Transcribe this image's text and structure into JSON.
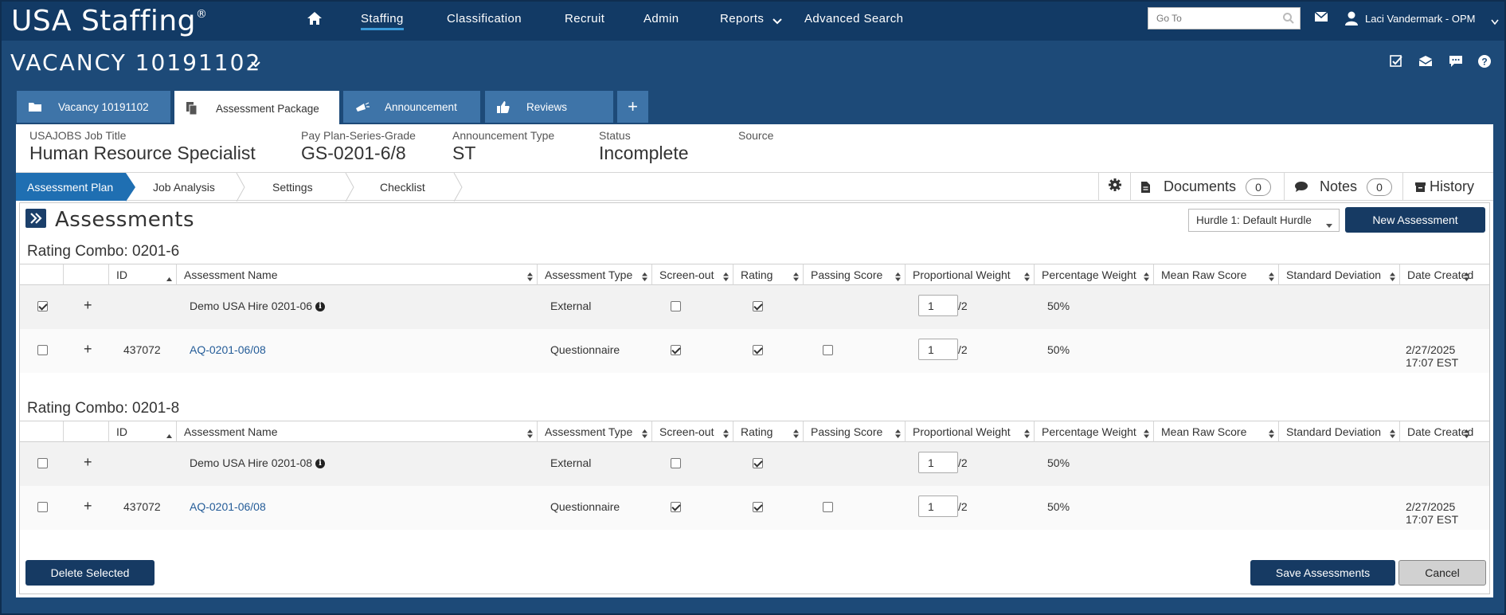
{
  "app": {
    "logo_text": "USA Staffing",
    "logo_mark": "®",
    "nav": [
      "Staffing",
      "Classification",
      "Recruit",
      "Admin",
      "Reports",
      "Advanced Search"
    ],
    "goto_placeholder": "Go To",
    "user_name": "Laci Vandermark - OPM"
  },
  "vacancy": {
    "title": "VACANCY 10191102"
  },
  "tabs": [
    "Vacancy 10191102",
    "Assessment Package",
    "Announcement",
    "Reviews",
    "+"
  ],
  "info": {
    "job_title_label": "USAJOBS Job Title",
    "job_title": "Human Resource Specialist",
    "pay_plan_label": "Pay Plan-Series-Grade",
    "pay_plan": "GS-0201-6/8",
    "announcement_type_label": "Announcement Type",
    "announcement_type": "ST",
    "status_label": "Status",
    "status": "Incomplete",
    "source_label": "Source"
  },
  "subnav": {
    "steps": [
      "Assessment Plan",
      "Job Analysis",
      "Settings",
      "Checklist"
    ],
    "documents_label": "Documents",
    "documents_count": "0",
    "notes_label": "Notes",
    "notes_count": "0",
    "history_label": "History"
  },
  "assessments": {
    "title": "Assessments",
    "hurdle_selected": "Hurdle 1: Default Hurdle",
    "new_button": "New Assessment",
    "columns": [
      "ID",
      "Assessment Name",
      "Assessment Type",
      "Screen-out",
      "Rating",
      "Passing Score",
      "Proportional Weight",
      "Percentage Weight",
      "Mean Raw Score",
      "Standard Deviation",
      "Date Created"
    ],
    "combos": [
      {
        "title": "Rating Combo: 0201-6",
        "rows": [
          {
            "selected": true,
            "id": "",
            "name": "Demo USA Hire 0201-06",
            "has_info": true,
            "is_link": false,
            "type": "External",
            "screen_out": false,
            "rating": true,
            "passing_score": null,
            "weight": "1",
            "weight_of": "/2",
            "pct": "50%",
            "date1": "",
            "date2": ""
          },
          {
            "selected": false,
            "id": "437072",
            "name": "AQ-0201-06/08",
            "has_info": false,
            "is_link": true,
            "type": "Questionnaire",
            "screen_out": true,
            "rating": true,
            "passing_score": false,
            "weight": "1",
            "weight_of": "/2",
            "pct": "50%",
            "date1": "2/27/2025",
            "date2": "17:07 EST"
          }
        ]
      },
      {
        "title": "Rating Combo: 0201-8",
        "rows": [
          {
            "selected": false,
            "id": "",
            "name": "Demo USA Hire 0201-08",
            "has_info": true,
            "is_link": false,
            "type": "External",
            "screen_out": false,
            "rating": true,
            "passing_score": null,
            "weight": "1",
            "weight_of": "/2",
            "pct": "50%",
            "date1": "",
            "date2": ""
          },
          {
            "selected": false,
            "id": "437072",
            "name": "AQ-0201-06/08",
            "has_info": false,
            "is_link": true,
            "type": "Questionnaire",
            "screen_out": true,
            "rating": true,
            "passing_score": false,
            "weight": "1",
            "weight_of": "/2",
            "pct": "50%",
            "date1": "2/27/2025",
            "date2": "17:07 EST"
          }
        ]
      }
    ]
  },
  "footer": {
    "delete_button": "Delete Selected",
    "save_button": "Save Assessments",
    "cancel_button": "Cancel"
  },
  "colors": {
    "nav_bg": "#123a65",
    "page_bg": "#1d4a78",
    "tab_bg": "#3e74a8",
    "active_step": "#1f6fb2",
    "primary_button": "#163a63",
    "link": "#245c98"
  },
  "icons": [
    "home-icon",
    "search-icon",
    "mail-icon",
    "user-icon",
    "chevron-down-icon",
    "checklist-icon",
    "inbox-icon",
    "chat-icon",
    "help-icon",
    "folder-icon",
    "documents-icon",
    "megaphone-icon",
    "thumbs-up-icon",
    "gear-icon",
    "document-icon",
    "comment-icon",
    "history-icon",
    "expand-icon",
    "info-icon"
  ]
}
